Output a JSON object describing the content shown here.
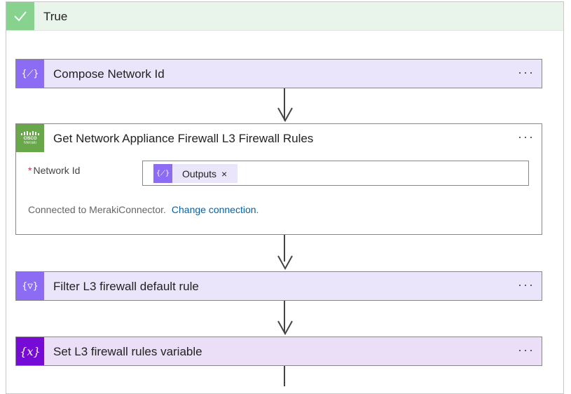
{
  "branch": {
    "title": "True",
    "status_color": "#86d28e",
    "icon": "check-icon"
  },
  "steps": [
    {
      "title": "Compose Network Id",
      "icon_text": "{⟋}",
      "icon": "compose-icon",
      "color": "#8c6cf4",
      "menu": "···"
    },
    {
      "title": "Get Network Appliance Firewall L3 Firewall Rules",
      "icon": "cisco-meraki-logo",
      "color": "#69a84a",
      "menu": "···",
      "field": {
        "label": "Network Id",
        "required_mark": "*",
        "token_label": "Outputs",
        "token_icon_text": "{⟋}",
        "token_remove": "×"
      },
      "connection": {
        "text": "Connected to MerakiConnector.",
        "link": "Change connection",
        "suffix": "."
      }
    },
    {
      "title": "Filter L3 firewall default rule",
      "icon_text": "{▽}",
      "icon": "filter-icon",
      "color": "#8c6cf4",
      "menu": "···"
    },
    {
      "title": "Set L3 firewall rules variable",
      "icon_text": "{x}",
      "icon": "variable-icon",
      "color": "#770bd6",
      "menu": "···"
    }
  ]
}
